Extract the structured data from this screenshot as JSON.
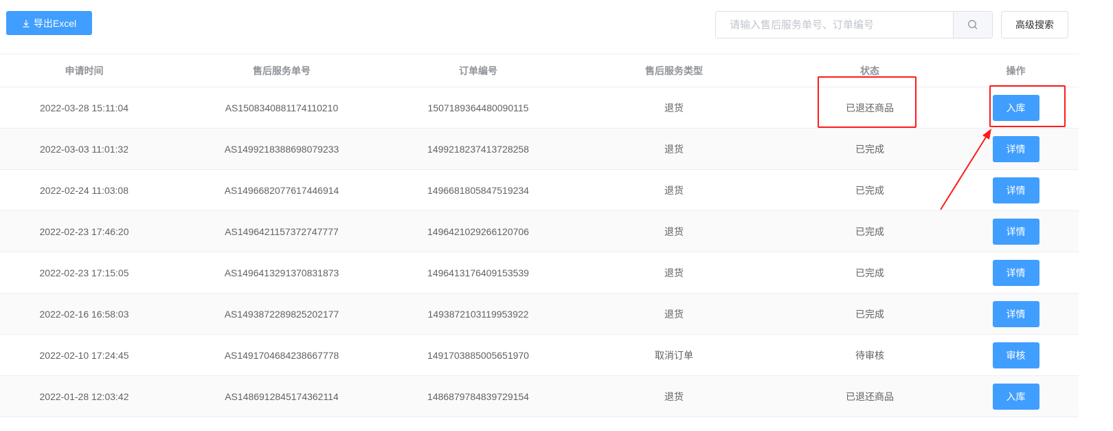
{
  "toolbar": {
    "export_label": "导出Excel",
    "export_icon": "download-icon",
    "search_placeholder": "请输入售后服务单号、订单编号",
    "search_value": "",
    "search_icon": "search-icon",
    "advanced_search_label": "高级搜索"
  },
  "table": {
    "columns": [
      "申请时间",
      "售后服务单号",
      "订单编号",
      "售后服务类型",
      "状态",
      "操作"
    ],
    "rows": [
      {
        "time": "2022-03-28 15:11:04",
        "service_no": "AS1508340881174110210",
        "order_no": "1507189364480090115",
        "type": "退货",
        "status": "已退还商品",
        "action": "入库"
      },
      {
        "time": "2022-03-03 11:01:32",
        "service_no": "AS1499218388698079233",
        "order_no": "1499218237413728258",
        "type": "退货",
        "status": "已完成",
        "action": "详情"
      },
      {
        "time": "2022-02-24 11:03:08",
        "service_no": "AS1496682077617446914",
        "order_no": "1496681805847519234",
        "type": "退货",
        "status": "已完成",
        "action": "详情"
      },
      {
        "time": "2022-02-23 17:46:20",
        "service_no": "AS1496421157372747777",
        "order_no": "1496421029266120706",
        "type": "退货",
        "status": "已完成",
        "action": "详情"
      },
      {
        "time": "2022-02-23 17:15:05",
        "service_no": "AS1496413291370831873",
        "order_no": "1496413176409153539",
        "type": "退货",
        "status": "已完成",
        "action": "详情"
      },
      {
        "time": "2022-02-16 16:58:03",
        "service_no": "AS1493872289825202177",
        "order_no": "1493872103119953922",
        "type": "退货",
        "status": "已完成",
        "action": "详情"
      },
      {
        "time": "2022-02-10 17:24:45",
        "service_no": "AS1491704684238667778",
        "order_no": "1491703885005651970",
        "type": "取消订单",
        "status": "待审核",
        "action": "审核"
      },
      {
        "time": "2022-01-28 12:03:42",
        "service_no": "AS1486912845174362114",
        "order_no": "1486879784839729154",
        "type": "退货",
        "status": "已退还商品",
        "action": "入库"
      }
    ]
  },
  "colors": {
    "primary": "#409eff",
    "annotation": "#ff1a1a",
    "stripe": "#fafafa"
  }
}
